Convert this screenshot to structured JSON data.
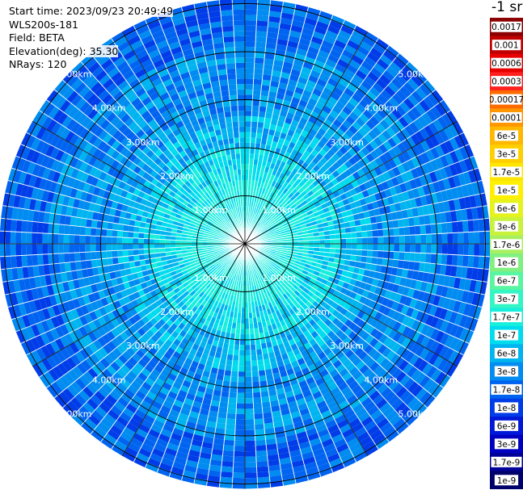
{
  "info": {
    "start_time_label": "Start time:",
    "start_time_value": "2023/09/23 20:49:49",
    "instrument": "WLS200s-181",
    "field_label": "Field:",
    "field_value": "BETA",
    "elevation_label": "Elevation(deg):",
    "elevation_value": "35.30",
    "nrays_label": "NRays:",
    "nrays_value": "120"
  },
  "colorbar": {
    "unit_label": "-1 sr",
    "ticks": [
      "0.0017",
      "0.001",
      "0.0006",
      "0.0003",
      "0.00017",
      "0.0001",
      "6e-5",
      "3e-5",
      "1.7e-5",
      "1e-5",
      "6e-6",
      "3e-6",
      "1.7e-6",
      "1e-6",
      "6e-7",
      "3e-7",
      "1.7e-7",
      "1e-7",
      "6e-8",
      "3e-8",
      "1.7e-8",
      "1e-8",
      "6e-9",
      "3e-9",
      "1.7e-9",
      "1e-9"
    ],
    "colors": [
      "#8b0000",
      "#c00000",
      "#e80000",
      "#ff2020",
      "#ff6a00",
      "#ff9600",
      "#ffb800",
      "#ffd000",
      "#ffe600",
      "#fff000",
      "#e6f21c",
      "#c9f23c",
      "#a8f060",
      "#80f080",
      "#5af5a0",
      "#34f5c4",
      "#18eedc",
      "#00dcee",
      "#00b4f0",
      "#008cf0",
      "#0064f0",
      "#003ce8",
      "#0018d8",
      "#0000c0",
      "#000098",
      "#00006a"
    ]
  },
  "chart_data": {
    "type": "heatmap",
    "projection": "polar-ppi",
    "field": "BETA",
    "n_rays": 120,
    "elevation_deg": 35.3,
    "range_ring_labels": [
      "1.00km",
      "2.00km",
      "3.00km",
      "4.00km",
      "5.00km"
    ],
    "range_rings_km": [
      1,
      2,
      3,
      4,
      5
    ],
    "max_range_km": 5.1,
    "spoke_angles_deg": [
      0,
      30,
      60,
      90,
      120,
      150,
      180,
      210,
      240,
      270,
      300,
      330
    ],
    "radial_profile_km": [
      0,
      1,
      1.7,
      2.3,
      3.0,
      3.8,
      4.5,
      5.1
    ],
    "radial_profile_beta": [
      "1.7e-7",
      "1.7e-7",
      "1e-7",
      "6e-8",
      "3e-8",
      "3e-8",
      "1.7e-8",
      "1.7e-8"
    ],
    "grid": true
  }
}
